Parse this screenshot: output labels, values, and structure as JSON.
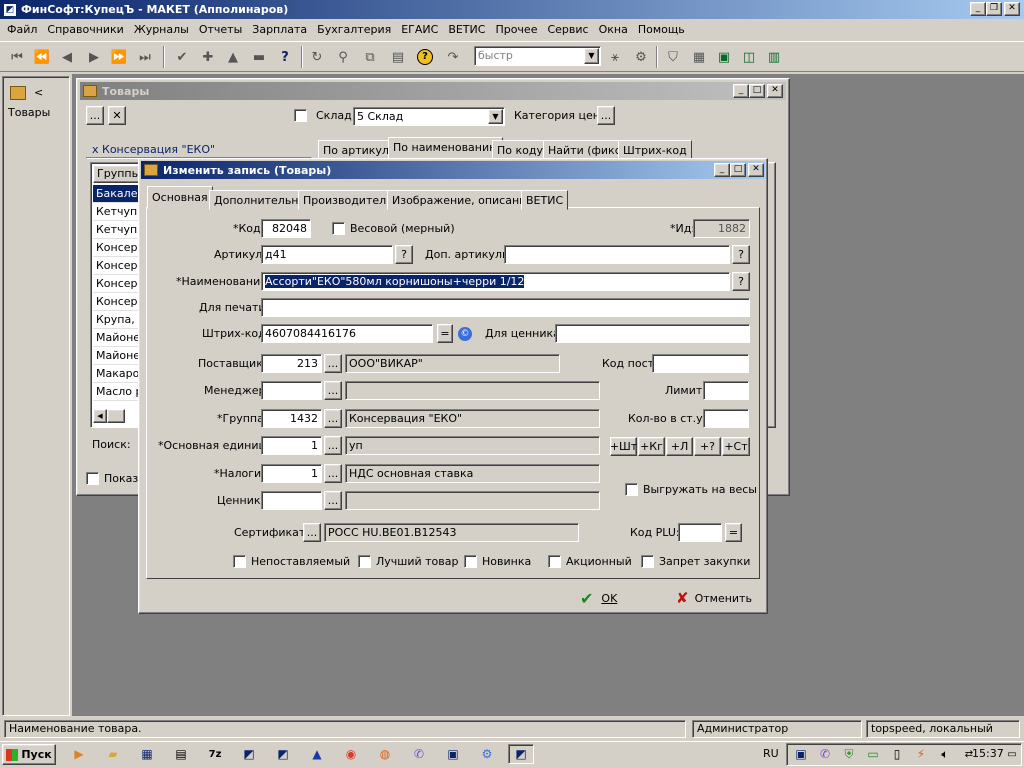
{
  "app": {
    "title": "ФинСофт:КупецЪ - МАКЕТ  (Апполинаров)"
  },
  "menu": [
    "Файл",
    "Справочники",
    "Журналы",
    "Отчеты",
    "Зарплата",
    "Бухгалтерия",
    "ЕГАИС",
    "ВЕТИС",
    "Прочее",
    "Сервис",
    "Окна",
    "Помощь"
  ],
  "toolbar": {
    "search_placeholder": "быстр"
  },
  "sidebar": {
    "label": "Товары",
    "arrow": "<"
  },
  "goods_window": {
    "title": "Товары",
    "warehouse_label": "Склад:",
    "warehouse_value": "5 Склад",
    "price_category_label": "Категория цен:",
    "filter_tag": "х  Консервация \"ЕКО\"",
    "search_tabs": [
      "По артикулу",
      "По наименованию",
      "По коду",
      "Найти (фикс)",
      "Штрих-код"
    ],
    "groups_header": "Группы",
    "list_rows": [
      "Бакалея",
      "Кетчуп \"",
      "Кетчуп и",
      "Консерв",
      "Консерв",
      "Консерв",
      "Консерв",
      "Крупа, с",
      "Майонез",
      "Майонез",
      "Макарон",
      "Масло р"
    ],
    "search_label": "Поиск:",
    "show_label": "Показ"
  },
  "dialog": {
    "title": "Изменить запись (Товары)",
    "tabs": [
      "Основная",
      "Дополнительно",
      "Производитель",
      "Изображение, описание",
      "ВЕТИС"
    ],
    "code_label": "*Код:",
    "code_value": "82048",
    "weight_label": "Весовой (мерный)",
    "id_label": "*Ид:",
    "id_value": "1882",
    "article_label": "Артикул:",
    "article_value": "д41",
    "extra_articles_label": "Доп. артикулы:",
    "name_label": "*Наименование:",
    "name_value": "Ассорти\"ЕКО\"580мл корнишоны+черри 1/12",
    "print_label": "Для печати:",
    "barcode_label": "Штрих-код:",
    "barcode_value": "4607084416176",
    "price_tag_label": "Для ценника:",
    "supplier_label": "Поставщик:",
    "supplier_code": "213",
    "supplier_name": "ООО\"ВИКАР\"",
    "supplier_post_code_label": "Код пост:",
    "manager_label": "Менеджер:",
    "limit_label": "Лимит:",
    "group_label": "*Группа:",
    "group_code": "1432",
    "group_name": "Консервация \"ЕКО\"",
    "qty_in_pack_label": "Кол-во в ст.уп:",
    "unit_label": "*Основная единица:",
    "unit_code": "1",
    "unit_name": "уп",
    "unit_buttons": [
      "+Шт",
      "+Кг",
      "+Л",
      "+?",
      "+Ст"
    ],
    "tax_label": "*Налоги:",
    "tax_code": "1",
    "tax_name": "НДС основная ставка",
    "upload_scales_label": "Выгружать на весы",
    "price_tag2_label": "Ценник:",
    "cert_label": "Сертификат:",
    "cert_value": "РОСС HU.BE01.B12543",
    "plu_label": "Код PLU:",
    "flags": [
      "Непоставляемый",
      "Лучший товар",
      "Новинка",
      "Акционный",
      "Запрет закупки"
    ],
    "ok_label": "OK",
    "cancel_label": "Отменить"
  },
  "statusbar": {
    "hint": "Наименование товара.",
    "user": "Администратор",
    "db": "topspeed, локальный"
  },
  "taskbar": {
    "start_label": "Пуск",
    "lang": "RU",
    "time": "15:37"
  },
  "colors": {
    "title_active": "#0a246a",
    "selection": "#0a246a",
    "desktop_mdi": "#808080",
    "face": "#d4d0c8"
  }
}
